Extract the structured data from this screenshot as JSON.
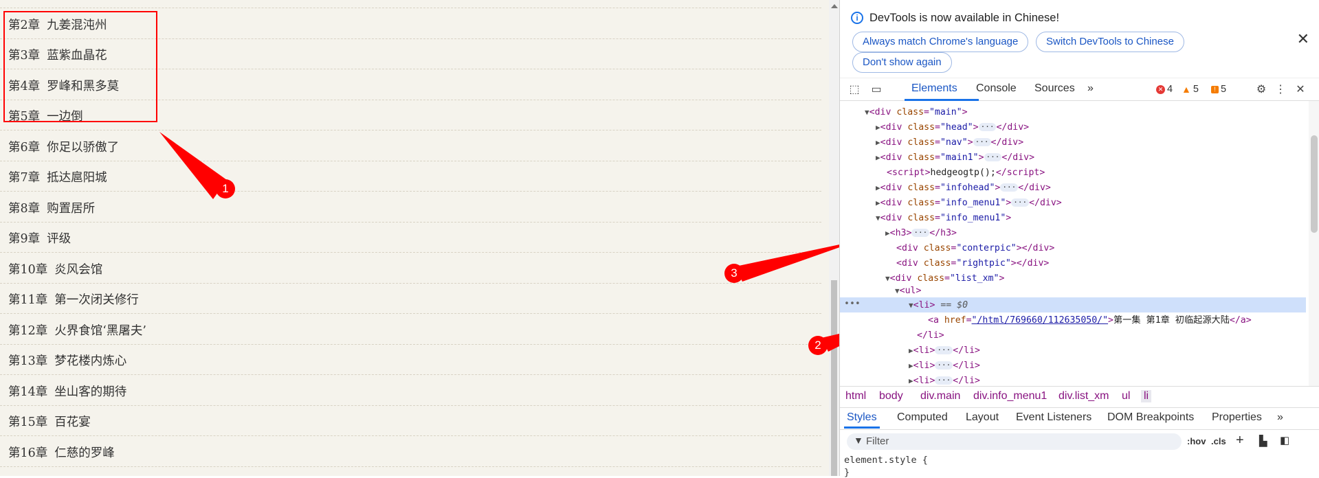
{
  "page": {
    "chapters": [
      {
        "num": "第2章",
        "title": "九姜混沌州"
      },
      {
        "num": "第3章",
        "title": "蓝紫血晶花"
      },
      {
        "num": "第4章",
        "title": "罗峰和黑多莫"
      },
      {
        "num": "第5章",
        "title": "一边倒"
      },
      {
        "num": "第6章",
        "title": "你足以骄傲了"
      },
      {
        "num": "第7章",
        "title": "抵达扈阳城"
      },
      {
        "num": "第8章",
        "title": "购置居所"
      },
      {
        "num": "第9章",
        "title": "评级"
      },
      {
        "num": "第10章",
        "title": "炎风会馆"
      },
      {
        "num": "第11章",
        "title": "第一次闭关修行"
      },
      {
        "num": "第12章",
        "title": "火界食馆‘黑屠夫’"
      },
      {
        "num": "第13章",
        "title": "梦花楼内炼心"
      },
      {
        "num": "第14章",
        "title": "坐山客的期待"
      },
      {
        "num": "第15章",
        "title": "百花宴"
      },
      {
        "num": "第16章",
        "title": "仁慈的罗峰"
      }
    ]
  },
  "annotations": {
    "badge1": "1",
    "badge2": "2",
    "badge3": "3",
    "color": "#ff0000"
  },
  "devtools": {
    "info_text": "DevTools is now available in Chinese!",
    "btn_match": "Always match Chrome's language",
    "btn_switch": "Switch DevTools to Chinese",
    "btn_dont_show": "Don't show again",
    "tabs": {
      "elements": "Elements",
      "console": "Console",
      "sources": "Sources",
      "more": "»"
    },
    "counts": {
      "errors": "4",
      "warnings": "5",
      "issues": "5"
    },
    "tree": {
      "main_cls": "\"main\"",
      "head_cls": "\"head\"",
      "nav_cls": "\"nav\"",
      "main1_cls": "\"main1\"",
      "script_text": "hedgeogtp();",
      "infohead_cls": "\"infohead\"",
      "info_menu1_cls": "\"info_menu1\"",
      "info_menu1b_cls": "\"info_menu1\"",
      "conterpic_cls": "\"conterpic\"",
      "rightpic_cls": "\"rightpic\"",
      "list_xm_cls": "\"list_xm\"",
      "selected_suffix": " == $0",
      "href": "\"/html/769660/112635050/\"",
      "link_text": "第一集 第1章 初临起源大陆"
    },
    "breadcrumbs": [
      "html",
      "body",
      "div.main",
      "div.info_menu1",
      "div.list_xm",
      "ul",
      "li"
    ],
    "subtabs": {
      "styles": "Styles",
      "computed": "Computed",
      "layout": "Layout",
      "listeners": "Event Listeners",
      "dom_bp": "DOM Breakpoints",
      "properties": "Properties",
      "more": "»"
    },
    "filter_placeholder": "Filter",
    "hov": ":hov",
    "cls": ".cls",
    "element_style": "element.style {",
    "element_style_close": "}"
  }
}
